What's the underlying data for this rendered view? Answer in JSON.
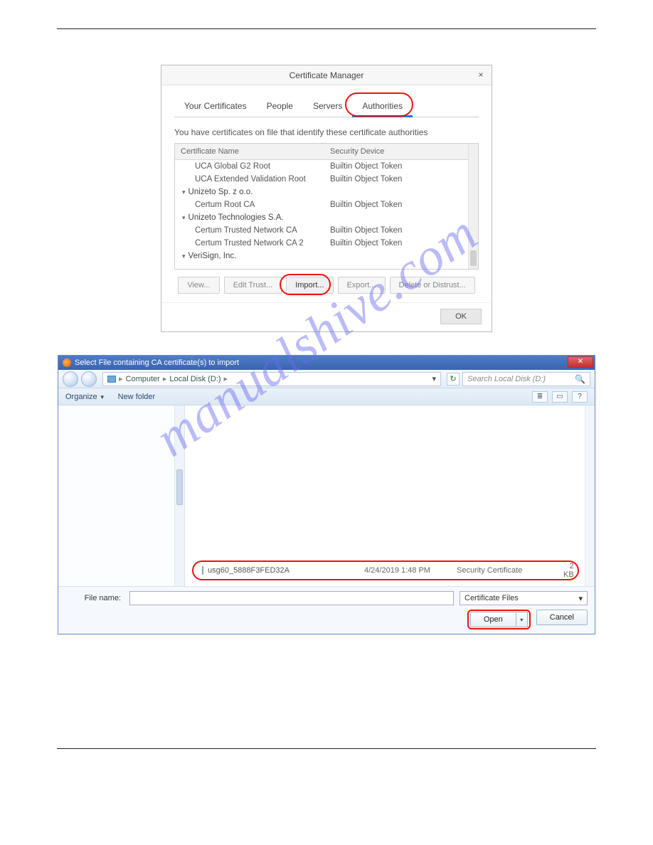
{
  "watermark": "manualshive.com",
  "certManager": {
    "title": "Certificate Manager",
    "closeGlyph": "×",
    "tabs": {
      "yourCerts": "Your Certificates",
      "people": "People",
      "servers": "Servers",
      "authorities": "Authorities"
    },
    "desc": "You have certificates on file that identify these certificate authorities",
    "columns": {
      "name": "Certificate Name",
      "device": "Security Device"
    },
    "rows": [
      {
        "type": "leaf",
        "name": "UCA Global G2 Root",
        "device": "Builtin Object Token"
      },
      {
        "type": "leaf",
        "name": "UCA Extended Validation Root",
        "device": "Builtin Object Token"
      },
      {
        "type": "group",
        "name": "Unizeto Sp. z o.o."
      },
      {
        "type": "leaf",
        "name": "Certum Root CA",
        "device": "Builtin Object Token"
      },
      {
        "type": "group",
        "name": "Unizeto Technologies S.A."
      },
      {
        "type": "leaf",
        "name": "Certum Trusted Network CA",
        "device": "Builtin Object Token"
      },
      {
        "type": "leaf",
        "name": "Certum Trusted Network CA 2",
        "device": "Builtin Object Token"
      },
      {
        "type": "group",
        "name": "VeriSign, Inc."
      }
    ],
    "buttons": {
      "view": "View...",
      "editTrust": "Edit Trust...",
      "import": "Import...",
      "export": "Export...",
      "delete": "Delete or Distrust..."
    },
    "ok": "OK"
  },
  "fileOpen": {
    "title": "Select File containing CA certificate(s) to import",
    "closeGlyph": "✕",
    "path": {
      "computer": "Computer",
      "disk": "Local Disk (D:)",
      "sep": "▸"
    },
    "refreshGlyph": "↻",
    "searchPlaceholder": "Search Local Disk (D:)",
    "searchIcon": "🔍",
    "toolbar": {
      "organize": "Organize",
      "newFolder": "New folder",
      "tri": "▼"
    },
    "viewIcons": {
      "list": "≣",
      "tiles": "▭",
      "help": "?"
    },
    "file": {
      "name": "usg60_5888F3FED32A",
      "date": "4/24/2019 1:48 PM",
      "type": "Security Certificate",
      "size": "2 KB"
    },
    "bottom": {
      "fileNameLabel": "File name:",
      "filter": "Certificate Files",
      "open": "Open",
      "cancel": "Cancel",
      "dd": "▾"
    }
  }
}
